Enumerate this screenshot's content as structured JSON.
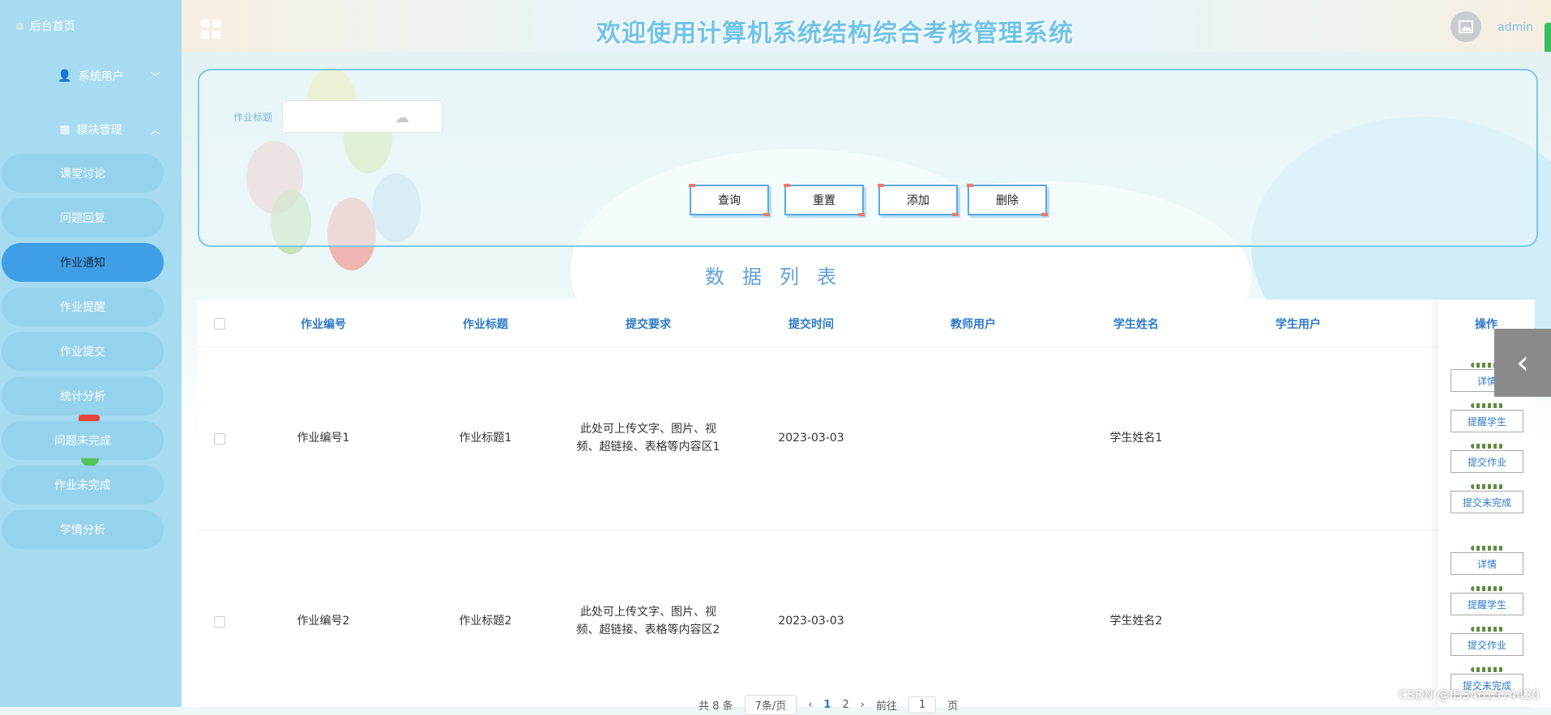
{
  "sidebar": {
    "home": "后台首页",
    "groups": [
      {
        "label": "系统用户",
        "chevron": "﹀"
      },
      {
        "label": "模块管理",
        "chevron": "︿"
      }
    ],
    "items": [
      {
        "label": "课堂讨论"
      },
      {
        "label": "问题回复"
      },
      {
        "label": "作业通知"
      },
      {
        "label": "作业提醒"
      },
      {
        "label": "作业提交"
      },
      {
        "label": "统计分析"
      },
      {
        "label": "问题未完成"
      },
      {
        "label": "作业未完成"
      },
      {
        "label": "学情分析"
      }
    ],
    "active": "作业通知"
  },
  "header": {
    "title": "欢迎使用计算机系统结构综合考核管理系统",
    "user": "admin"
  },
  "search": {
    "label": "作业标题",
    "value": "",
    "buttons": {
      "query": "查询",
      "reset": "重置",
      "add": "添加",
      "delete": "删除"
    }
  },
  "list_title": "数据列表",
  "table": {
    "headers": [
      "作业编号",
      "作业标题",
      "提交要求",
      "提交时间",
      "教师用户",
      "学生姓名",
      "学生用户",
      "操作"
    ],
    "rows": [
      {
        "no": "作业编号1",
        "title": "作业标题1",
        "req_line1": "此处可上传文字、图片、视",
        "req_line2": "频、超链接、表格等内容区1",
        "time": "2023-03-03",
        "teacher": "",
        "student_name": "学生姓名1",
        "student_user": ""
      },
      {
        "no": "作业编号2",
        "title": "作业标题2",
        "req_line1": "此处可上传文字、图片、视",
        "req_line2": "频、超链接、表格等内容区2",
        "time": "2023-03-03",
        "teacher": "",
        "student_name": "学生姓名2",
        "student_user": ""
      }
    ],
    "actions": [
      "详情",
      "提醒学生",
      "提交作业",
      "提交未完成"
    ]
  },
  "pagination": {
    "total": "共 8 条",
    "page_size": "7条/页",
    "prev": "‹",
    "pages": [
      "1",
      "2"
    ],
    "next": "›",
    "goto_label": "前往",
    "goto_value": "1",
    "page_unit": "页"
  },
  "watermark": "CSDN @ID3461974420",
  "colors": {
    "sidebar": "#a6dbf2",
    "active_item": "#3f9ee6",
    "accent": "#2e7ac8",
    "title": "#6fc3e6"
  }
}
